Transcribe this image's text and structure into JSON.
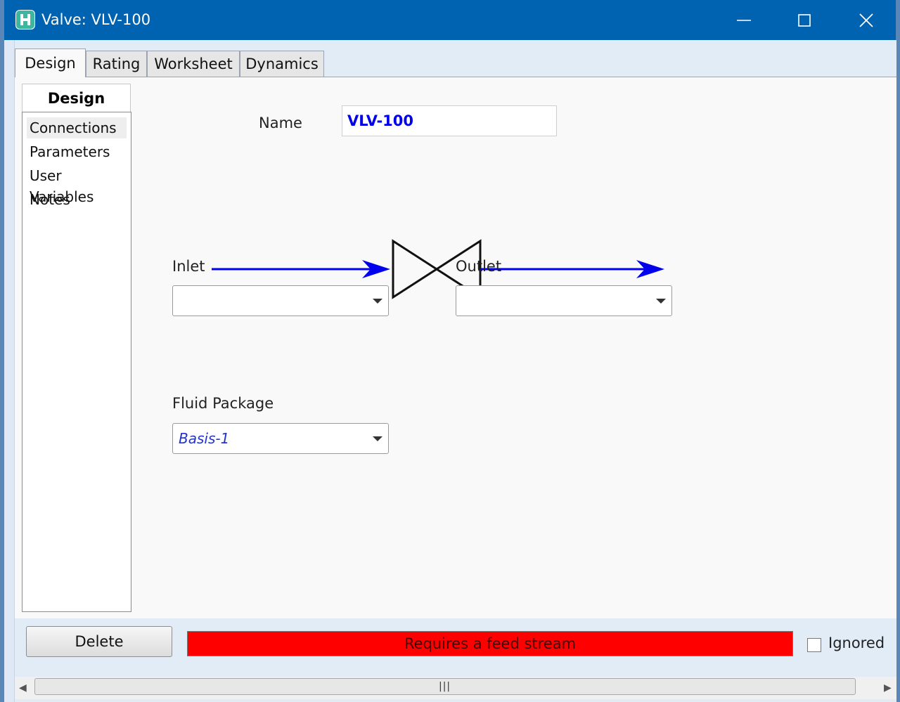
{
  "window": {
    "title": "Valve: VLV-100",
    "app_icon_letter": "H"
  },
  "tabs": [
    {
      "label": "Design",
      "active": true
    },
    {
      "label": "Rating",
      "active": false
    },
    {
      "label": "Worksheet",
      "active": false
    },
    {
      "label": "Dynamics",
      "active": false
    }
  ],
  "sidebar": {
    "header": "Design",
    "items": [
      {
        "label": "Connections",
        "selected": true
      },
      {
        "label": "Parameters",
        "selected": false
      },
      {
        "label": "User Variables",
        "selected": false
      },
      {
        "label": "Notes",
        "selected": false
      }
    ]
  },
  "form": {
    "name_label": "Name",
    "name_value": "VLV-100",
    "inlet_label": "Inlet",
    "inlet_value": "",
    "outlet_label": "Outlet",
    "outlet_value": "",
    "fluid_package_label": "Fluid Package",
    "fluid_package_value": "Basis-1"
  },
  "footer": {
    "delete_label": "Delete",
    "status_text": "Requires a feed stream",
    "status_color": "#ff0000",
    "ignored_label": "Ignored",
    "ignored_checked": false
  },
  "colors": {
    "titlebar": "#0063b1",
    "stream_arrow": "#0000ee"
  },
  "icons": {
    "minimize": "minimize-icon",
    "maximize": "maximize-icon",
    "close": "close-icon",
    "dropdown": "chevron-down-icon",
    "scroll_left": "scroll-left-icon",
    "scroll_right": "scroll-right-icon"
  }
}
